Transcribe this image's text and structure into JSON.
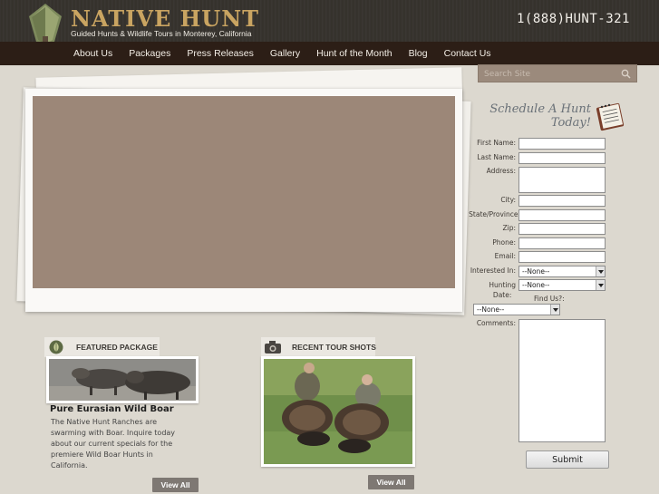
{
  "header": {
    "brand": "NATIVE HUNT",
    "tagline": "Guided Hunts & Wildlife Tours in Monterey, California",
    "phone": "1(888)HUNT-321"
  },
  "nav": {
    "items": [
      "About Us",
      "Packages",
      "Press Releases",
      "Gallery",
      "Hunt of the Month",
      "Blog",
      "Contact Us"
    ]
  },
  "search": {
    "placeholder": "Search Site"
  },
  "schedule": {
    "title_line1": "Schedule A Hunt",
    "title_line2": "Today!",
    "fields": {
      "first_name": "First Name:",
      "last_name": "Last Name:",
      "address": "Address:",
      "city": "City:",
      "state": "State/Province:",
      "zip": "Zip:",
      "phone": "Phone:",
      "email": "Email:",
      "interested_in": "Interested In:",
      "hunting_date_1": "Hunting",
      "hunting_date_2": "Date:",
      "find_us": "Find Us?:",
      "comments": "Comments:"
    },
    "selects": {
      "interested_in": "--None--",
      "hunting_date": "--None--",
      "find_us": "--None--"
    },
    "submit": "Submit"
  },
  "featured": {
    "tab": "FEATURED PACKAGE",
    "title": "Pure Eurasian Wild Boar",
    "description": "The Native Hunt Ranches are swarming with Boar. Inquire today about our current specials for the premiere Wild Boar Hunts in California.",
    "view_all": "View All"
  },
  "recent": {
    "tab": "RECENT TOUR SHOTS",
    "view_all": "View All"
  },
  "colors": {
    "background": "#dcd8cf",
    "header": "#3a3631",
    "nav": "#2c1e16",
    "brand_gold": "#c9a461",
    "slider_image": "#9c8778"
  }
}
